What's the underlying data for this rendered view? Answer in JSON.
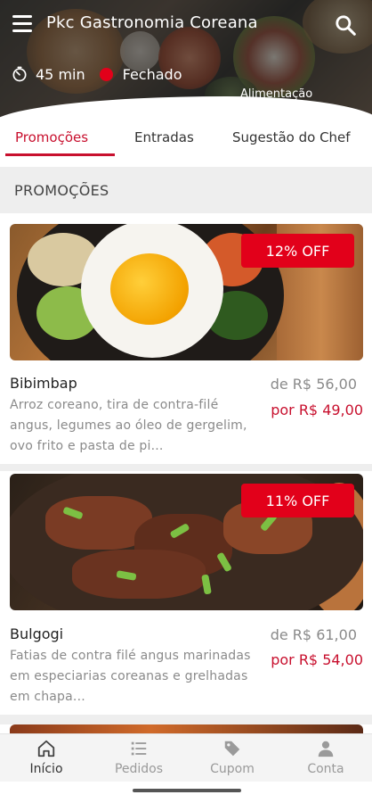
{
  "header": {
    "title": "Pkc Gastronomia Coreana",
    "delivery_time": "45 min",
    "status": "Fechado",
    "category": "Alimentação",
    "status_color": "#e2001a"
  },
  "tabs": [
    {
      "label": "Promoções",
      "active": true
    },
    {
      "label": "Entradas",
      "active": false
    },
    {
      "label": "Sugestão do Chef",
      "active": false
    }
  ],
  "section": {
    "title": "PROMOÇÕES"
  },
  "products": [
    {
      "name": "Bibimbap",
      "description": "Arroz coreano, tira de contra-filé angus, legumes ao óleo de gergelim, ovo frito e pasta de pi...",
      "old_price": "de R$ 56,00",
      "new_price": "por R$ 49,00",
      "discount": "12% OFF"
    },
    {
      "name": "Bulgogi",
      "description": "Fatias de contra filé angus marinadas em especiarias coreanas e grelhadas em chapa...",
      "old_price": "de R$ 61,00",
      "new_price": "por R$ 54,00",
      "discount": "11% OFF"
    }
  ],
  "bottom_nav": [
    {
      "label": "Início",
      "icon": "home-icon",
      "active": true
    },
    {
      "label": "Pedidos",
      "icon": "list-icon",
      "active": false
    },
    {
      "label": "Cupom",
      "icon": "tag-icon",
      "active": false
    },
    {
      "label": "Conta",
      "icon": "user-icon",
      "active": false
    }
  ],
  "colors": {
    "accent": "#c8102e",
    "badge": "#e2001a"
  }
}
